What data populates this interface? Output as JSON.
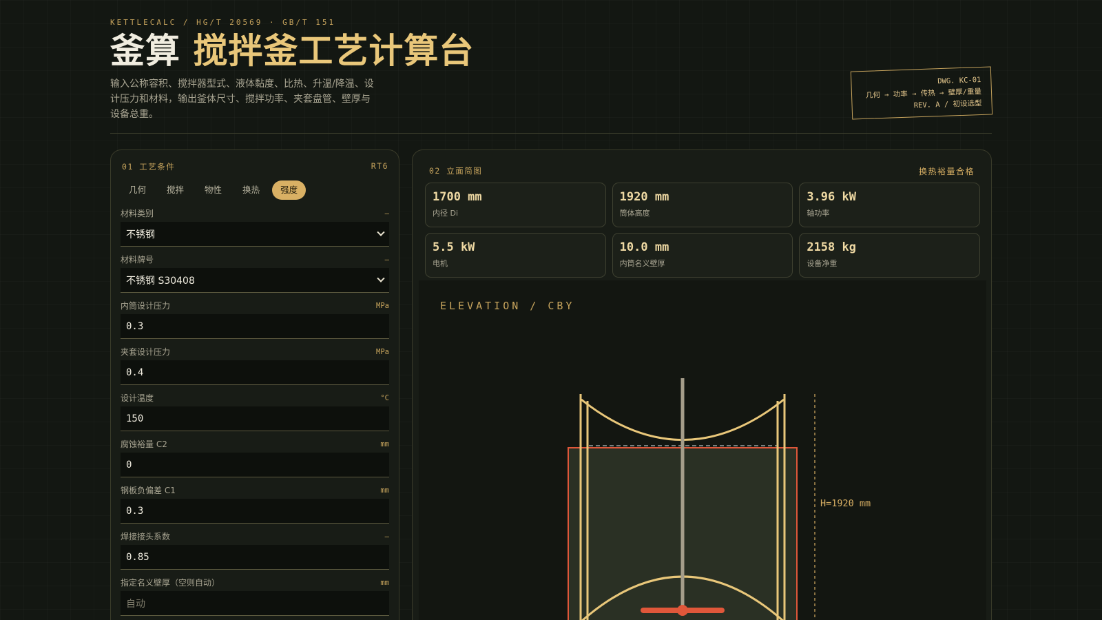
{
  "header": {
    "kicker": "KETTLECALC / HG/T 20569 · GB/T 151",
    "title_main": "釜算",
    "title_accent": "搅拌釜工艺计算台",
    "subtitle": "输入公称容积、搅拌器型式、液体黏度、比热、升温/降温、设计压力和材料，输出釜体尺寸、搅拌功率、夹套盘管、壁厚与设备总重。",
    "stamp": {
      "line1": "DWG. KC-01",
      "line2": "几何 → 功率 → 传热 → 壁厚/重量",
      "line3": "REV. A / 初设选型"
    }
  },
  "left_panel": {
    "title": "01 工艺条件",
    "code": "RT6",
    "tabs": [
      {
        "label": "几何",
        "active": false
      },
      {
        "label": "搅拌",
        "active": false
      },
      {
        "label": "物性",
        "active": false
      },
      {
        "label": "换热",
        "active": false
      },
      {
        "label": "强度",
        "active": true
      }
    ],
    "fields": [
      {
        "label": "材料类别",
        "unit": "–",
        "value": "不锈钢",
        "type": "select"
      },
      {
        "label": "材料牌号",
        "unit": "–",
        "value": "不锈钢 S30408",
        "type": "select"
      },
      {
        "label": "内筒设计压力",
        "unit": "MPa",
        "value": "0.3",
        "type": "input"
      },
      {
        "label": "夹套设计压力",
        "unit": "MPa",
        "value": "0.4",
        "type": "input"
      },
      {
        "label": "设计温度",
        "unit": "°C",
        "value": "150",
        "type": "input"
      },
      {
        "label": "腐蚀裕量 C2",
        "unit": "mm",
        "value": "0",
        "type": "input"
      },
      {
        "label": "钢板负偏差 C1",
        "unit": "mm",
        "value": "0.3",
        "type": "input"
      },
      {
        "label": "焊接接头系数",
        "unit": "–",
        "value": "0.85",
        "type": "input"
      },
      {
        "label": "指定名义壁厚（空则自动）",
        "unit": "mm",
        "value": "",
        "placeholder": "自动",
        "type": "input"
      }
    ]
  },
  "right_panel": {
    "title": "02 立面简图",
    "status": "换热裕量合格",
    "metrics": [
      {
        "value": "1700 mm",
        "label": "内径 Di"
      },
      {
        "value": "1920 mm",
        "label": "筒体高度"
      },
      {
        "value": "3.96 kW",
        "label": "轴功率"
      },
      {
        "value": "5.5 kW",
        "label": "电机"
      },
      {
        "value": "10.0 mm",
        "label": "内筒名义壁厚"
      },
      {
        "value": "2158 kg",
        "label": "设备净重"
      }
    ],
    "drawing": {
      "label": "ELEVATION / CBY",
      "height_label": "H=1920 mm"
    }
  },
  "colors": {
    "accent": "#e9c77a",
    "gold": "#c7a45d",
    "jacket": "#e0573a",
    "panel": "#181c16",
    "background": "#131712"
  }
}
